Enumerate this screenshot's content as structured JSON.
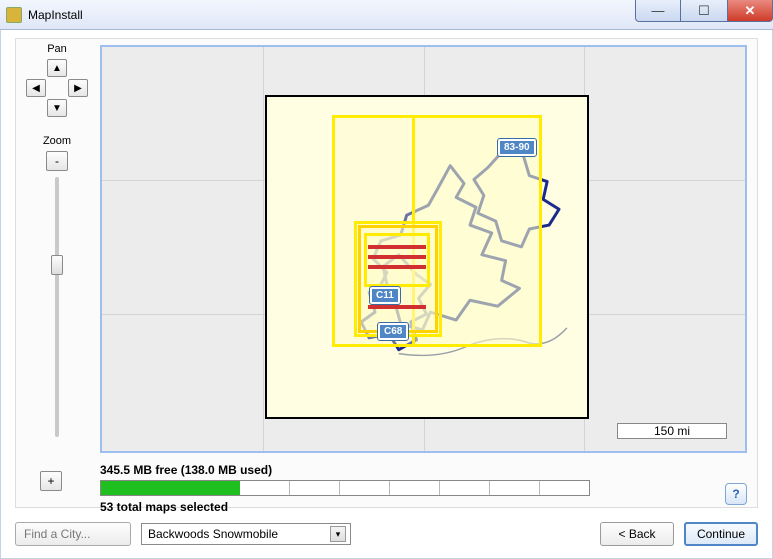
{
  "window": {
    "title": "MapInstall"
  },
  "controls": {
    "pan_label": "Pan",
    "zoom_label": "Zoom",
    "zoom_out_label": "-",
    "plus_label": "+"
  },
  "map": {
    "scale_label": "150 mi",
    "labels": {
      "ne": "83-90",
      "c11": "C11",
      "c68": "C68"
    }
  },
  "status": {
    "free_line": "345.5 MB free (138.0 MB used)",
    "used_fraction": 0.285,
    "selected_line": "53 total maps selected"
  },
  "bottom": {
    "find_city": "Find a City...",
    "dropdown_value": "Backwoods Snowmobile",
    "back": "< Back",
    "continue": "Continue"
  }
}
